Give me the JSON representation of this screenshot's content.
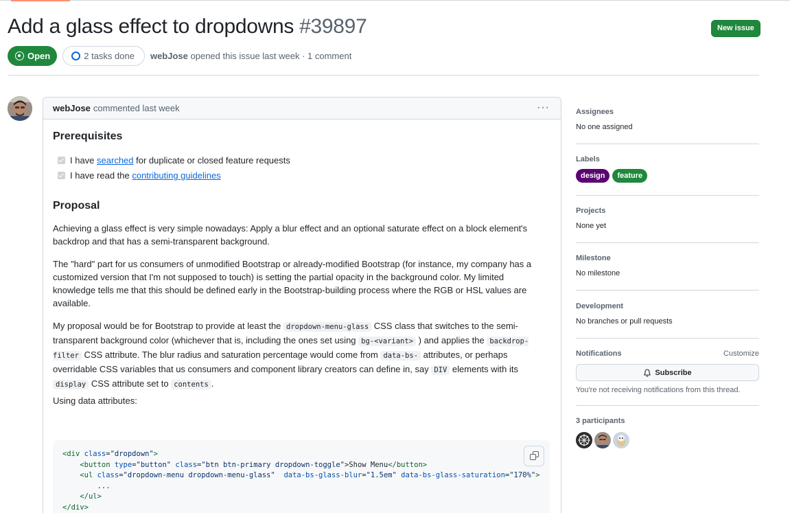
{
  "issue": {
    "title": "Add a glass effect to dropdowns",
    "number": "#39897",
    "state": "Open",
    "tasks": "2 tasks done",
    "author": "webJose",
    "opened_text": "opened this issue last week · 1 comment",
    "new_issue_label": "New issue"
  },
  "comment": {
    "author": "webJose",
    "meta": "commented last week",
    "prerequisites_heading": "Prerequisites",
    "task1": {
      "pre": "I have ",
      "link": "searched",
      "post": " for duplicate or closed feature requests"
    },
    "task2": {
      "pre": "I have read the ",
      "link": "contributing guidelines"
    },
    "proposal_heading": "Proposal",
    "p1": "Achieving a glass effect is very simple nowadays: Apply a blur effect and an optional saturate effect on a block element's backdrop and that has a semi-transparent background.",
    "p2": "The \"hard\" part for us consumers of unmodified Bootstrap or already-modified Bootstrap (for instance, my company has a customized version that I'm not supposed to touch) is setting the partial opacity in the background color. My limited knowledge tells me that this should be defined early in the Bootstrap-building process where the RGB or HSL values are available.",
    "p3": {
      "t1": "My proposal would be for Bootstrap to provide at least the ",
      "c1": "dropdown-menu-glass",
      "t2": " CSS class that switches to the semi-transparent background color (whichever that is, including the ones set using ",
      "c2": "bg-<variant>",
      "t3": " ) and applies the ",
      "c3": "backdrop-filter",
      "t4": " CSS attribute. The blur radius and saturation percentage would come from ",
      "c4": "data-bs-",
      "t5": " attributes, or perhaps overridable CSS variables that us consumers and component library creators can define in, say ",
      "c5": "DIV",
      "t6": " elements with its ",
      "c6": "display",
      "t7": " CSS attribute set to ",
      "c7": "contents",
      "t8": "."
    },
    "p4": "Using data attributes:",
    "code": {
      "l1_tag": "<div",
      "l1_attr": "class",
      "l1_val": "\"dropdown\"",
      "l1_end": ">",
      "l2_tag": "<button",
      "l2_a1": "type",
      "l2_v1": "\"button\"",
      "l2_a2": "class",
      "l2_v2": "\"btn btn-primary dropdown-toggle\"",
      "l2_text": ">Show Menu",
      "l2_close": "</button>",
      "l3_tag": "<ul",
      "l3_a1": "class",
      "l3_v1": "\"dropdown-menu dropdown-menu-glass\"",
      "l3_a2": "data-bs-glass-blur",
      "l3_v2": "\"1.5em\"",
      "l3_a3": "data-bs-glass-saturation",
      "l3_v3": "\"170%\"",
      "l3_end": ">",
      "l4": "...",
      "l5": "</ul>",
      "l6": "</div>"
    }
  },
  "sidebar": {
    "assignees_heading": "Assignees",
    "assignees_value": "No one assigned",
    "labels_heading": "Labels",
    "labels": [
      {
        "name": "design",
        "color": "#5a0572"
      },
      {
        "name": "feature",
        "color": "#1f883d"
      }
    ],
    "projects_heading": "Projects",
    "projects_value": "None yet",
    "milestone_heading": "Milestone",
    "milestone_value": "No milestone",
    "development_heading": "Development",
    "development_value": "No branches or pull requests",
    "notifications_heading": "Notifications",
    "customize_label": "Customize",
    "subscribe_label": "Subscribe",
    "notifications_note": "You're not receiving notifications from this thread.",
    "participants_heading": "3 participants"
  },
  "colors": {
    "accent_green": "#1f883d",
    "link_blue": "#0969da",
    "label_design": "#5a0572"
  }
}
